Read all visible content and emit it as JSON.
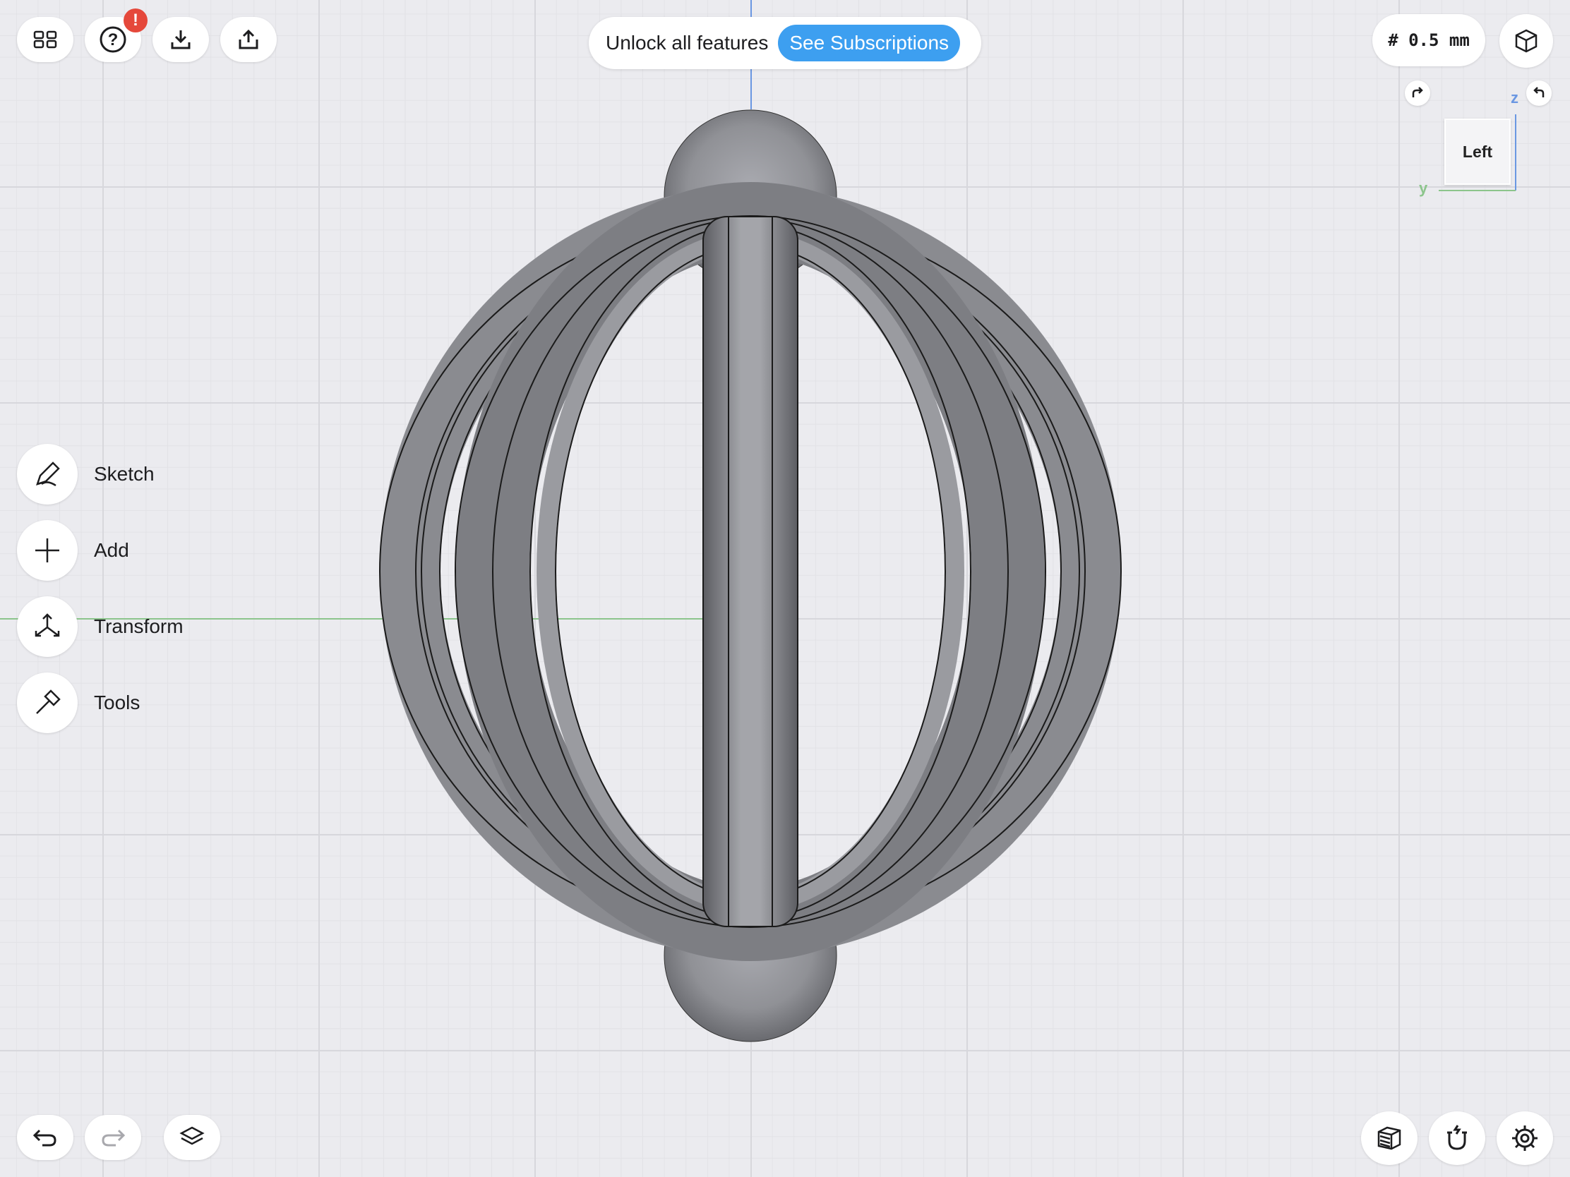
{
  "toolbar": {
    "menu_icon": "grid-icon",
    "help_icon": "help-icon",
    "help_badge": "!",
    "import_icon": "download-icon",
    "export_icon": "share-icon"
  },
  "promo": {
    "text": "Unlock all features",
    "cta_label": "See Subscriptions",
    "cta_color": "#3d9ff0"
  },
  "grid_size": "# 0.5 mm",
  "view_cube": {
    "face_label": "Left",
    "axis_z": "z",
    "axis_y": "y",
    "axis_colors": {
      "z": "#6a97e2",
      "y": "#8cc58c"
    }
  },
  "tools": [
    {
      "label": "Sketch",
      "icon": "pen-icon"
    },
    {
      "label": "Add",
      "icon": "plus-icon"
    },
    {
      "label": "Transform",
      "icon": "transform-icon"
    },
    {
      "label": "Tools",
      "icon": "hammer-icon"
    }
  ],
  "bottom_bar": {
    "undo_icon": "undo-icon",
    "redo_icon": "redo-icon",
    "layers_icon": "layers-icon",
    "render_icon": "render-mode-icon",
    "snap_icon": "magnet-icon",
    "settings_icon": "gear-icon"
  }
}
